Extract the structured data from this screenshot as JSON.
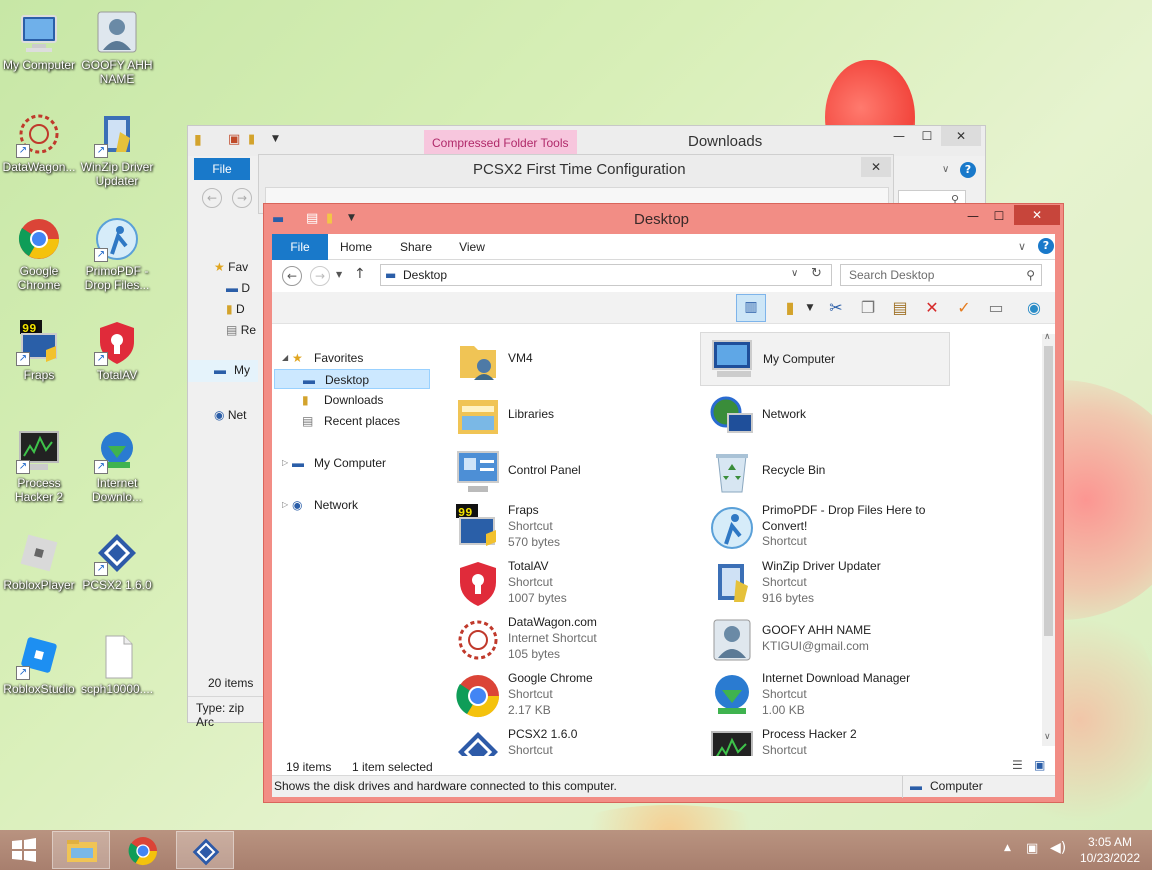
{
  "desktop_icons": [
    {
      "label": "My Computer"
    },
    {
      "label": "GOOFY AHH NAME"
    },
    {
      "label": "DataWagon..."
    },
    {
      "label": "WinZip Driver Updater"
    },
    {
      "label": "Google Chrome"
    },
    {
      "label": "PrimoPDF - Drop Files..."
    },
    {
      "label": "Fraps"
    },
    {
      "label": "TotalAV"
    },
    {
      "label": "Process Hacker 2"
    },
    {
      "label": "Internet Downlo..."
    },
    {
      "label": "RobloxPlayer"
    },
    {
      "label": "PCSX2 1.6.0"
    },
    {
      "label": "RobloxStudio"
    },
    {
      "label": "scph10000...."
    }
  ],
  "downloads_window": {
    "title": "Downloads",
    "context_tab": "Compressed Folder Tools",
    "file_tab": "File",
    "nav": [
      "Fav",
      "D",
      "D",
      "Re",
      "My",
      "Net"
    ],
    "items_count": "20 items",
    "status": "Type: zip Arc"
  },
  "pcsx2_window": {
    "title": "PCSX2 First Time Configuration"
  },
  "desktop_window": {
    "title": "Desktop",
    "tabs": [
      "File",
      "Home",
      "Share",
      "View"
    ],
    "address": "Desktop",
    "search_placeholder": "Search Desktop",
    "nav": {
      "favorites": "Favorites",
      "desktop": "Desktop",
      "downloads": "Downloads",
      "recent": "Recent places",
      "my_computer": "My Computer",
      "network": "Network"
    },
    "items": [
      {
        "name": "VM4",
        "sub1": "",
        "sub2": ""
      },
      {
        "name": "My Computer",
        "sub1": "",
        "sub2": ""
      },
      {
        "name": "Libraries",
        "sub1": "",
        "sub2": ""
      },
      {
        "name": "Network",
        "sub1": "",
        "sub2": ""
      },
      {
        "name": "Control Panel",
        "sub1": "",
        "sub2": ""
      },
      {
        "name": "Recycle Bin",
        "sub1": "",
        "sub2": ""
      },
      {
        "name": "Fraps",
        "sub1": "Shortcut",
        "sub2": "570 bytes"
      },
      {
        "name": "PrimoPDF - Drop Files Here to Convert!",
        "sub1": "Shortcut",
        "sub2": ""
      },
      {
        "name": "TotalAV",
        "sub1": "Shortcut",
        "sub2": "1007 bytes"
      },
      {
        "name": "WinZip Driver Updater",
        "sub1": "Shortcut",
        "sub2": "916 bytes"
      },
      {
        "name": "DataWagon.com",
        "sub1": "Internet Shortcut",
        "sub2": "105 bytes"
      },
      {
        "name": "GOOFY AHH NAME",
        "sub1": "KTIGUI@gmail.com",
        "sub2": ""
      },
      {
        "name": "Google Chrome",
        "sub1": "Shortcut",
        "sub2": "2.17 KB"
      },
      {
        "name": "Internet Download Manager",
        "sub1": "Shortcut",
        "sub2": "1.00 KB"
      },
      {
        "name": "PCSX2 1.6.0",
        "sub1": "Shortcut",
        "sub2": ""
      },
      {
        "name": "Process Hacker 2",
        "sub1": "Shortcut",
        "sub2": ""
      }
    ],
    "status_items": "19 items",
    "status_selected": "1 item selected",
    "info_text": "Shows the disk drives and hardware connected to this computer.",
    "info_location": "Computer"
  },
  "taskbar": {
    "time": "3:05 AM",
    "date": "10/23/2022"
  },
  "colors": {
    "accent_file_tab": "#1979ca",
    "desktop_window_frame": "#f28d85",
    "context_tab": "#f7c6dd",
    "taskbar": "#b08877"
  }
}
